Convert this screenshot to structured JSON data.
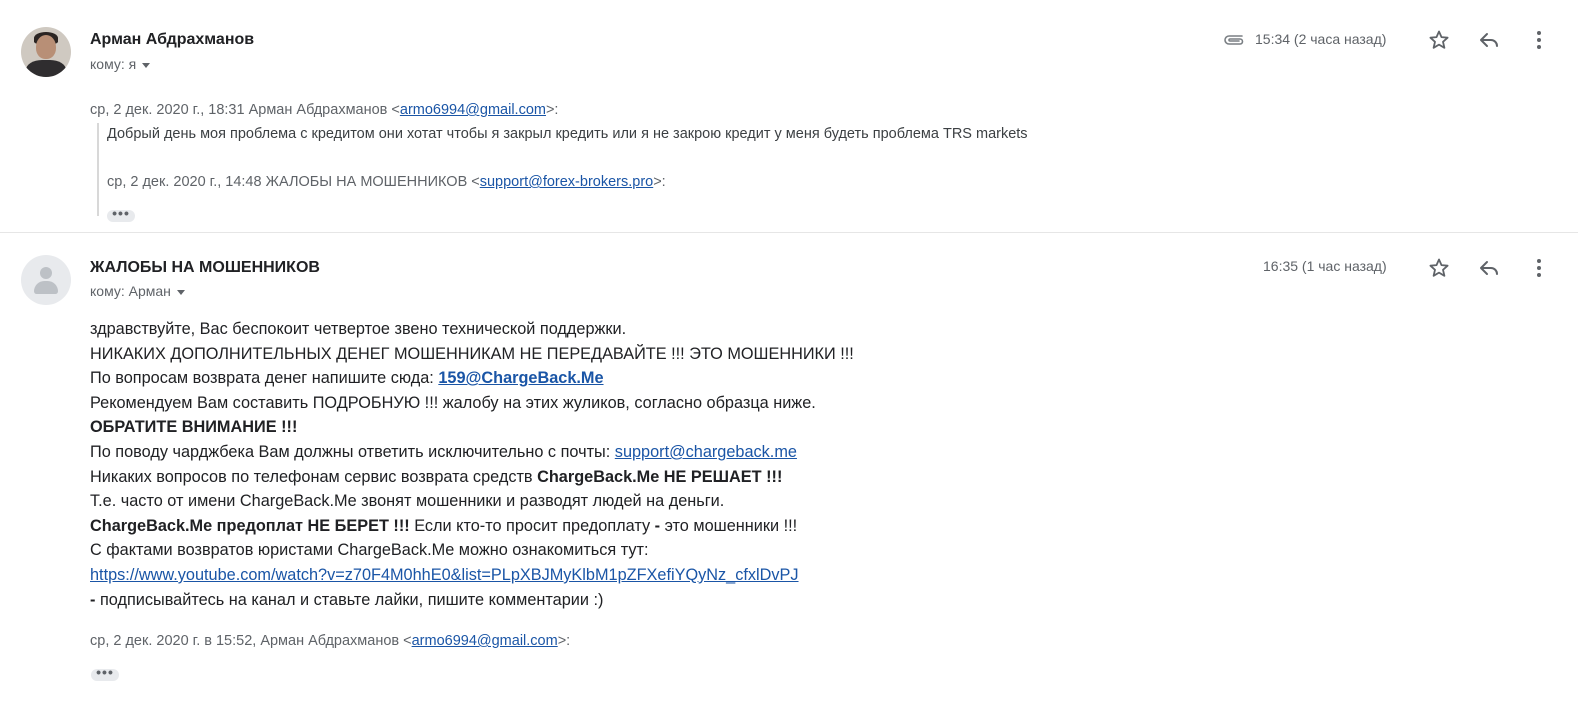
{
  "messages": [
    {
      "sender": "Арман Абдрахманов",
      "to": "кому: я",
      "time": "15:34 (2 часа назад)",
      "quoted_header": {
        "prefix": "ср, 2 дек. 2020 г., 18:31 Арман Абдрахманов <",
        "email": "armo6994@gmail.com",
        "suffix": ">:"
      },
      "quoted_body": "Добрый день моя проблема с кредитом они хотат чтобы я закрыл кредить или я не закрою кредит у меня будеть проблема TRS markets",
      "inner_header": {
        "prefix": "ср, 2 дек. 2020 г., 14:48 ЖАЛОБЫ НА МОШЕННИКОВ <",
        "email": "support@forex-brokers.pro",
        "suffix": ">:"
      },
      "dots": "•••"
    },
    {
      "sender": "ЖАЛОБЫ НА МОШЕННИКОВ",
      "to": "кому: Арман",
      "time": "16:35 (1 час назад)",
      "body": {
        "l1": "здравствуйте, Вас беспокоит четвертое звено технической поддержки.",
        "l2": "НИКАКИХ ДОПОЛНИТЕЛЬНЫХ ДЕНЕГ МОШЕННИКАМ НЕ ПЕРЕДАВАЙТЕ !!! ЭТО МОШЕННИКИ !!!",
        "l3_text": "По вопросам возврата денег напишите сюда: ",
        "l3_link": "159@ChargeBack.Me",
        "l4": "Рекомендуем Вам составить ПОДРОБНУЮ !!! жалобу на этих жуликов, согласно образца ниже.",
        "l5": "ОБРАТИТЕ ВНИМАНИЕ !!!",
        "l6_text": "По поводу чарджбека Вам должны ответить исключительно с почты: ",
        "l6_link": "support@chargeback.me",
        "l7_text": "Никаких вопросов по телефонам сервис возврата средств ",
        "l7_bold": "ChargeBack.Me НЕ РЕШАЕТ !!!",
        "l8": "Т.е. часто от имени ChargeBack.Me звонят мошенники и разводят людей на деньги.",
        "l9_bold": "ChargeBack.Me предоплат НЕ БЕРЕТ !!!",
        "l9_text": " Если кто-то просит предоплату ",
        "l9_dash": "-",
        "l9_text2": " это мошенники !!!",
        "l10": "С фактами возвратов юристами ChargeBack.Me можно ознакомиться тут:",
        "l11_link": "https://www.youtube.com/watch?v=z70F4M0hhE0&list=PLpXBJMyKlbM1pZFXefiYQyNz_cfxlDvPJ",
        "l12_dash": " -",
        "l12_text": " подписывайтесь на канал и ставьте лайки, пишите комментарии :)"
      },
      "quoted_header": {
        "prefix": "ср, 2 дек. 2020 г. в 15:52, Арман Абдрахманов <",
        "email": "armo6994@gmail.com",
        "suffix": ">:"
      },
      "dots": "•••"
    }
  ],
  "icons": {
    "attachment": "paperclip-icon",
    "star": "star-icon",
    "reply": "reply-icon",
    "more": "more-vert-icon"
  },
  "colors": {
    "link": "#1a55a6",
    "chargeback_link": "#1a30b8",
    "meta_text": "#5f6368"
  }
}
